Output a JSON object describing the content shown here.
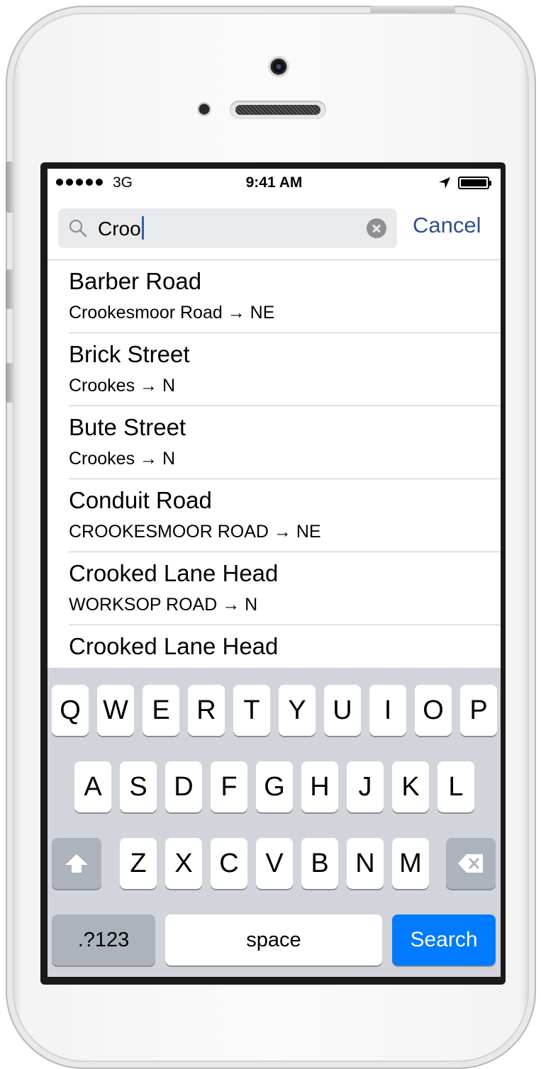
{
  "status_bar": {
    "carrier": "3G",
    "time": "9:41 AM"
  },
  "search": {
    "query": "Croo",
    "cancel_label": "Cancel"
  },
  "results": [
    {
      "title": "Barber Road",
      "subtitle": "Crookesmoor Road → NE"
    },
    {
      "title": "Brick Street",
      "subtitle": "Crookes → N"
    },
    {
      "title": "Bute Street",
      "subtitle": "Crookes → N"
    },
    {
      "title": "Conduit Road",
      "subtitle": "CROOKESMOOR ROAD → NE"
    },
    {
      "title": "Crooked Lane Head",
      "subtitle": "WORKSOP ROAD → N"
    },
    {
      "title": "Crooked Lane Head",
      "subtitle": ""
    }
  ],
  "keyboard": {
    "row1": [
      "Q",
      "W",
      "E",
      "R",
      "T",
      "Y",
      "U",
      "I",
      "O",
      "P"
    ],
    "row2": [
      "A",
      "S",
      "D",
      "F",
      "G",
      "H",
      "J",
      "K",
      "L"
    ],
    "row3": [
      "Z",
      "X",
      "C",
      "V",
      "B",
      "N",
      "M"
    ],
    "numbers_label": ".?123",
    "space_label": "space",
    "search_label": "Search"
  },
  "icons": {
    "search": "magnifier-icon",
    "clear": "clear-circle-icon",
    "location": "location-arrow-icon",
    "shift": "shift-arrow-icon",
    "delete": "backspace-icon"
  },
  "colors": {
    "accent": "#007aff",
    "cancel": "#30508f",
    "keyboard_bg": "#d1d5db"
  }
}
